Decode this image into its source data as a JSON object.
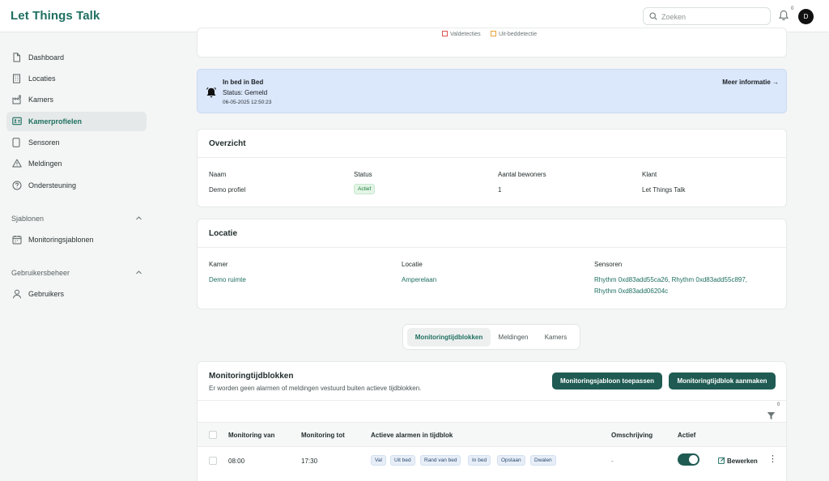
{
  "header": {
    "brand": "Let Things Talk",
    "search_placeholder": "Zoeken",
    "notification_count": "0",
    "avatar_initial": "D"
  },
  "sidebar": {
    "items": [
      {
        "label": "Dashboard",
        "icon": "file-icon"
      },
      {
        "label": "Locaties",
        "icon": "building-icon"
      },
      {
        "label": "Kamers",
        "icon": "factory-icon"
      },
      {
        "label": "Kamerprofielen",
        "icon": "id-card-icon",
        "active": true
      },
      {
        "label": "Sensoren",
        "icon": "device-icon"
      },
      {
        "label": "Meldingen",
        "icon": "warning-icon"
      },
      {
        "label": "Ondersteuning",
        "icon": "help-icon"
      }
    ],
    "templates_section": "Sjablonen",
    "templates_items": [
      {
        "label": "Monitoringsjablonen",
        "icon": "calendar-icon"
      }
    ],
    "users_section": "Gebruikersbeheer",
    "users_items": [
      {
        "label": "Gebruikers",
        "icon": "user-icon"
      }
    ]
  },
  "legend": {
    "fall": "Valdetecties",
    "out_of_bed": "Uit-beddetectie",
    "fall_color": "#e05252",
    "out_color": "#e8a23a"
  },
  "alert": {
    "title": "In bed in Bed",
    "status": "Status: Gemeld",
    "timestamp": "06-05-2025 12:50:23",
    "more": "Meer informatie →"
  },
  "overview": {
    "title": "Overzicht",
    "headers": {
      "name": "Naam",
      "status": "Status",
      "residents": "Aantal bewoners",
      "client": "Klant"
    },
    "values": {
      "name": "Demo profiel",
      "status": "Actief",
      "residents": "1",
      "client": "Let Things Talk"
    }
  },
  "location": {
    "title": "Locatie",
    "headers": {
      "room": "Kamer",
      "location": "Locatie",
      "sensors": "Sensoren"
    },
    "values": {
      "room": "Demo ruimte",
      "location": "Amperelaan",
      "sensors_line1": "Rhythm 0xd83add55ca26, Rhythm 0xd83add55c897,",
      "sensors_line2": "Rhythm 0xd83add06204c"
    }
  },
  "tabs": [
    "Monitoringtijdblokken",
    "Meldingen",
    "Kamers"
  ],
  "monitoring": {
    "title": "Monitoringtijdblokken",
    "subtitle": "Er worden geen alarmen of meldingen vestuurd buiten actieve tijdblokken.",
    "apply_template_button": "Monitoringsjabloon toepassen",
    "create_block_button": "Monitoringtijdblok aanmaken",
    "filter_count": "0",
    "columns": [
      "Monitoring van",
      "Monitoring tot",
      "Actieve alarmen in tijdblok",
      "Omschrijving",
      "Actief"
    ],
    "rows": [
      {
        "from": "08:00",
        "to": "17:30",
        "alarms": [
          "Val",
          "Uit bed",
          "Rand van bed",
          "In bed",
          "Opstaan",
          "Dwalen"
        ],
        "description": "-",
        "active": true,
        "edit_label": "Bewerken"
      }
    ]
  }
}
